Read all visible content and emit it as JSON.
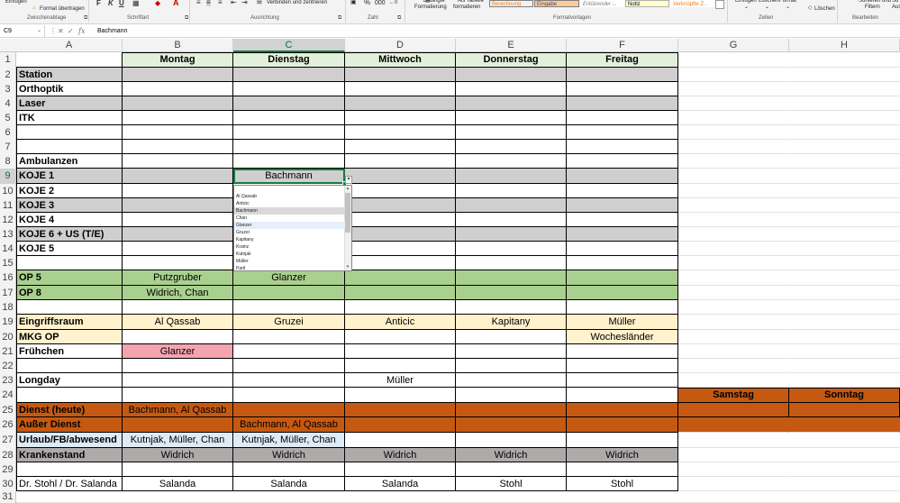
{
  "ribbon": {
    "einfuegen": "Einfügen",
    "format_uebertragen": "Format übertragen",
    "bold": "F",
    "italic": "K",
    "underline": "U",
    "verbinden": "Verbinden und zentrieren",
    "bedingte": [
      "Bedingte",
      "Formatierung"
    ],
    "als_tabelle": [
      "Als Tabelle",
      "formatieren"
    ],
    "styles": [
      {
        "label": "Berechnung",
        "bg": "#f2f2f2",
        "color": "#fa7d00",
        "border": "#7f7f7f"
      },
      {
        "label": "Eingabe",
        "bg": "#ffcc99",
        "color": "#3f3f76",
        "border": "#7f7f7f"
      },
      {
        "label": "Erklärender ...",
        "bg": "#ffffff",
        "color": "#7f7f7f",
        "border": "#ffffff"
      },
      {
        "label": "Notiz",
        "bg": "#ffffcc",
        "color": "#000000",
        "border": "#b2b2b2"
      },
      {
        "label": "Verknüpfte Z...",
        "bg": "#ffffff",
        "color": "#fa7d00",
        "border": "#ffffff"
      }
    ],
    "einfuegen2": "Einfügen",
    "loeschen": "Löschen",
    "format": "Format",
    "loeschen2": "Löschen",
    "sortieren": [
      "Sortieren und",
      "Filtern"
    ],
    "suchen_kurz": [
      "Su",
      "Aus"
    ],
    "groups": {
      "zwischenablage": "Zwischenablage",
      "schriftart": "Schriftart",
      "ausrichtung": "Ausrichtung",
      "zahl": "Zahl",
      "formatvorlagen": "Formatvorlagen",
      "zellen": "Zellen",
      "bearbeiten": "Bearbeiten"
    }
  },
  "formula_bar": {
    "name_box": "C9",
    "fx": "fx",
    "value": "Bachmann"
  },
  "columns": [
    "A",
    "B",
    "C",
    "D",
    "E",
    "F",
    "G",
    "H"
  ],
  "rows": [
    {
      "n": "1",
      "cells": [
        "",
        "Montag",
        "Dienstag",
        "Mittwoch",
        "Donnerstag",
        "Freitag",
        "",
        ""
      ]
    },
    {
      "n": "2",
      "cells": [
        "Station",
        "",
        "",
        "",
        "",
        "",
        "",
        ""
      ]
    },
    {
      "n": "3",
      "cells": [
        "Orthoptik",
        "",
        "",
        "",
        "",
        "",
        "",
        ""
      ]
    },
    {
      "n": "4",
      "cells": [
        "Laser",
        "",
        "",
        "",
        "",
        "",
        "",
        ""
      ]
    },
    {
      "n": "5",
      "cells": [
        "ITK",
        "",
        "",
        "",
        "",
        "",
        "",
        ""
      ]
    },
    {
      "n": "6",
      "cells": [
        "",
        "",
        "",
        "",
        "",
        "",
        "",
        ""
      ]
    },
    {
      "n": "7",
      "cells": [
        "",
        "",
        "",
        "",
        "",
        "",
        "",
        ""
      ]
    },
    {
      "n": "8",
      "cells": [
        "Ambulanzen",
        "",
        "",
        "",
        "",
        "",
        "",
        ""
      ]
    },
    {
      "n": "9",
      "cells": [
        "KOJE 1",
        "",
        "Bachmann",
        "",
        "",
        "",
        "",
        ""
      ]
    },
    {
      "n": "10",
      "cells": [
        "KOJE 2",
        "",
        "",
        "",
        "",
        "",
        "",
        ""
      ]
    },
    {
      "n": "11",
      "cells": [
        "KOJE 3",
        "",
        "",
        "",
        "",
        "",
        "",
        ""
      ]
    },
    {
      "n": "12",
      "cells": [
        "KOJE 4",
        "",
        "",
        "",
        "",
        "",
        "",
        ""
      ]
    },
    {
      "n": "13",
      "cells": [
        "KOJE 6 + US (T/E)",
        "",
        "",
        "",
        "",
        "",
        "",
        ""
      ]
    },
    {
      "n": "14",
      "cells": [
        "KOJE 5",
        "",
        "",
        "",
        "",
        "",
        "",
        ""
      ]
    },
    {
      "n": "15",
      "cells": [
        "",
        "",
        "",
        "",
        "",
        "",
        "",
        ""
      ]
    },
    {
      "n": "16",
      "cells": [
        "OP 5",
        "Putzgruber",
        "Glanzer",
        "",
        "",
        "",
        "",
        ""
      ]
    },
    {
      "n": "17",
      "cells": [
        "OP 8",
        "Widrich, Chan",
        "",
        "",
        "",
        "",
        "",
        ""
      ]
    },
    {
      "n": "18",
      "cells": [
        "",
        "",
        "",
        "",
        "",
        "",
        "",
        ""
      ]
    },
    {
      "n": "19",
      "cells": [
        "Eingriffsraum",
        "Al Qassab",
        "Gruzei",
        "Anticic",
        "Kapitany",
        "Müller",
        "",
        ""
      ]
    },
    {
      "n": "20",
      "cells": [
        "MKG OP",
        "",
        "",
        "",
        "",
        "Wocheslӓnder",
        "",
        ""
      ]
    },
    {
      "n": "21",
      "cells": [
        "Frühchen",
        "Glanzer",
        "",
        "",
        "",
        "",
        "",
        ""
      ]
    },
    {
      "n": "22",
      "cells": [
        "",
        "",
        "",
        "",
        "",
        "",
        "",
        ""
      ]
    },
    {
      "n": "23",
      "cells": [
        "Longday",
        "",
        "",
        "Müller",
        "",
        "",
        "",
        ""
      ]
    },
    {
      "n": "24",
      "cells": [
        "",
        "",
        "",
        "",
        "",
        "",
        "Samstag",
        "Sonntag"
      ]
    },
    {
      "n": "25",
      "cells": [
        "Dienst (heute)",
        "Bachmann, Al Qassab",
        "",
        "",
        "",
        "",
        "",
        ""
      ]
    },
    {
      "n": "26",
      "cells": [
        "Außer Dienst",
        "",
        "Bachmann, Al Qassab",
        "",
        "",
        "",
        "",
        ""
      ]
    },
    {
      "n": "27",
      "cells": [
        "Urlaub/FB/abwesend",
        "Kutnjak, Müller, Chan",
        "Kutnjak, Müller, Chan",
        "",
        "",
        "",
        "",
        ""
      ]
    },
    {
      "n": "28",
      "cells": [
        "Krankenstand",
        "Widrich",
        "Widrich",
        "Widrich",
        "Widrich",
        "Widrich",
        "",
        ""
      ]
    },
    {
      "n": "29",
      "cells": [
        "",
        "",
        "",
        "",
        "",
        "",
        "",
        ""
      ]
    },
    {
      "n": "30",
      "cells": [
        "Dr. Stohl / Dr. Salanda",
        "Salanda",
        "Salanda",
        "Salanda",
        "Stohl",
        "Stohl",
        "",
        ""
      ]
    },
    {
      "n": "31",
      "cells": [
        "",
        "",
        "",
        "",
        "",
        "",
        "",
        ""
      ]
    }
  ],
  "dropdown": {
    "items": [
      "Al Qassab",
      "Anticic",
      "Bachmann",
      "Chan",
      "Glanzer",
      "Gruzei",
      "Kapitany",
      "Krainz",
      "Kutnjak",
      "Müller",
      "Partl"
    ],
    "highlighted": "Bachmann",
    "hovered": "Glanzer"
  },
  "colors": {
    "header_green": "#e2efda",
    "gray": "#d0cece",
    "op_green": "#a9d08e",
    "cream": "#fff2cc",
    "pink": "#f4a4b0",
    "orange": "#c65911",
    "lightblue": "#ddebf7",
    "krank_gray": "#aeaaaa",
    "accent": "#107c41"
  }
}
